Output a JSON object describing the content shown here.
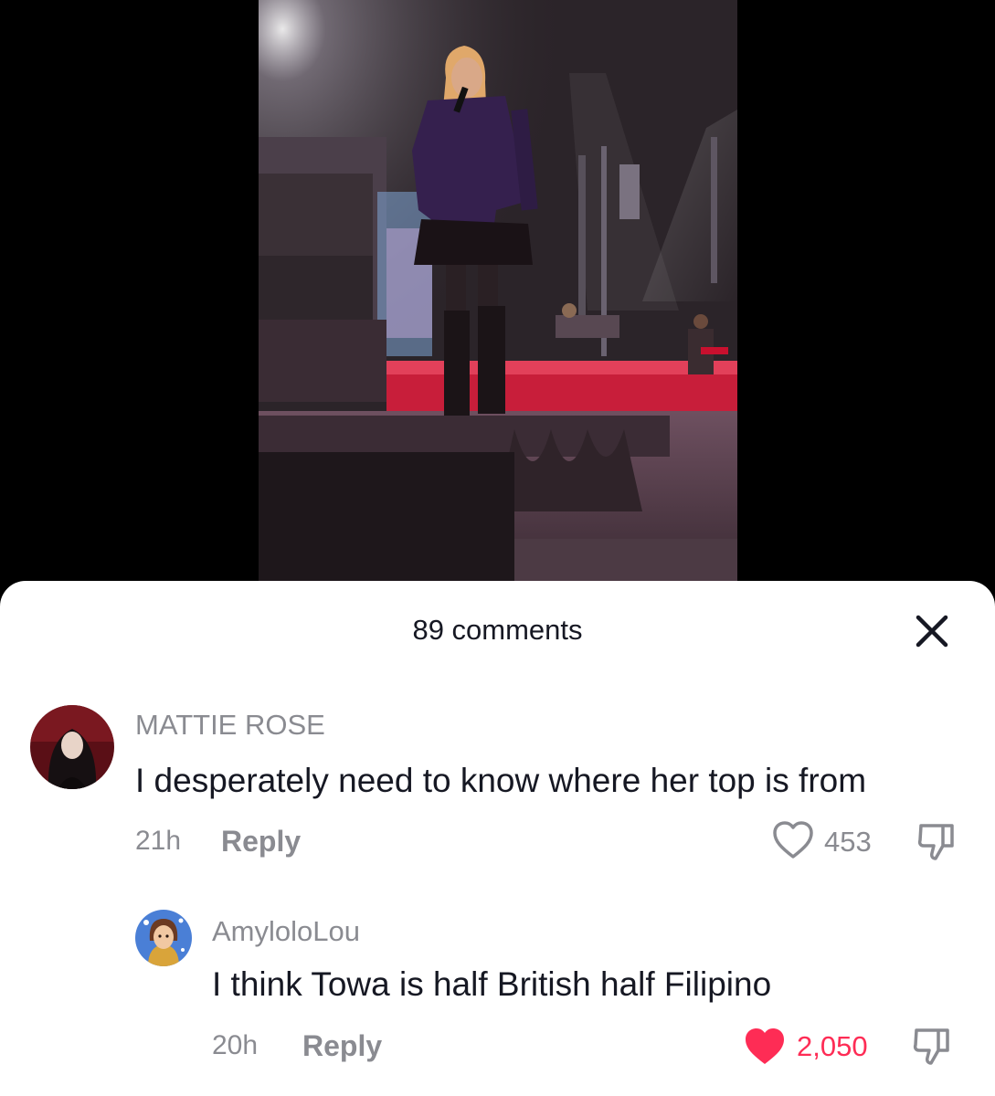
{
  "sheet": {
    "title": "89 comments"
  },
  "comments": [
    {
      "username": "MATTIE ROSE",
      "text": "I desperately need to know where her top is from",
      "time": "21h",
      "reply_label": "Reply",
      "likes": "453",
      "liked": false
    },
    {
      "username": "AmyloloLou",
      "text": "I think Towa is half British half Filipino",
      "time": "20h",
      "reply_label": "Reply",
      "likes": "2,050",
      "liked": true
    }
  ],
  "colors": {
    "text_primary": "#161823",
    "text_secondary": "#8a8b91",
    "like_active": "#fe2c55",
    "sheet_bg": "#ffffff",
    "backdrop": "#000000"
  },
  "icons": {
    "close": "close-icon",
    "like": "heart-icon",
    "dislike": "thumbs-down-icon"
  }
}
